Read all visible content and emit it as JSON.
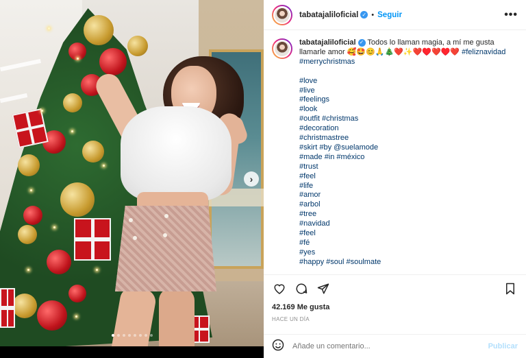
{
  "post": {
    "username": "tabatajaliloficial",
    "follow_label": "Seguir",
    "separator": "•",
    "more_label": "•••"
  },
  "caption": {
    "username": "tabatajaliloficial",
    "text": "Todos lo llaman magia, a mí me gusta llamarle amor 🥰🤩😊🙏🎄❤️✨❤️♥️❤️♥️❤️",
    "first_hashtag": "#feliznavidad",
    "second_hashtag": "#merrychristmas",
    "hashtag_lines": [
      "#love",
      "#live",
      "#feelings",
      "#look",
      "#outfit #christmas",
      "#decoration",
      "#christmastree",
      "#skirt #by @suelamode",
      "#made #in #méxico",
      "#trust",
      "#feel",
      "#life",
      "#amor",
      "#arbol",
      "#tree",
      "#navidad",
      "#feel",
      "#fé",
      "#yes",
      "#happy #soul #soulmate"
    ]
  },
  "stats": {
    "likes": "42.169 Me gusta",
    "time_ago": "HACE UN DÍA"
  },
  "comment": {
    "placeholder": "Añade un comentario...",
    "publish_label": "Publicar"
  },
  "carousel": {
    "slide_count": 8,
    "active_index": 0,
    "next_label": "›"
  },
  "colors": {
    "link": "#00376b",
    "follow": "#0095f6",
    "muted": "#8e8e8e"
  },
  "icons": [
    "heart-icon",
    "comment-icon",
    "share-icon",
    "bookmark-icon",
    "emoji-icon",
    "verified-icon",
    "more-icon"
  ]
}
